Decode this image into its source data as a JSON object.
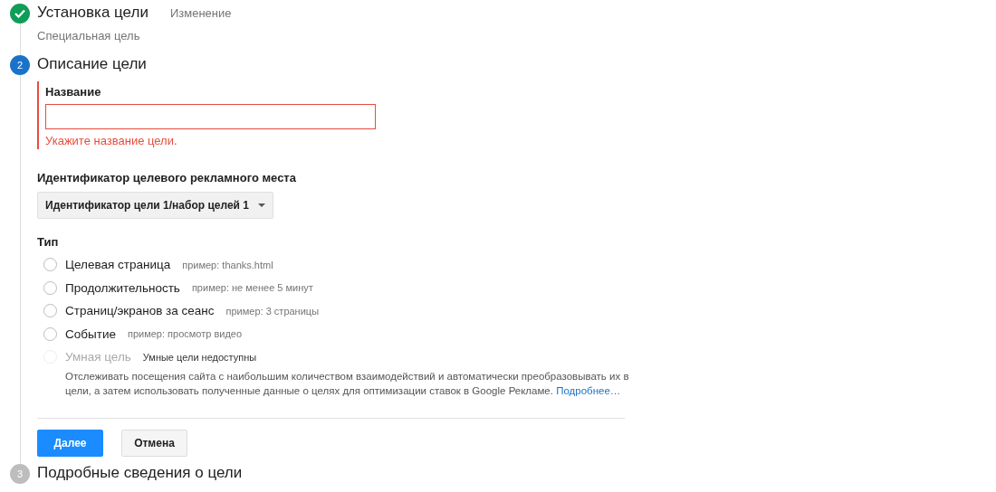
{
  "steps": [
    {
      "done": true,
      "title": "Установка цели",
      "action": "Изменение",
      "summary": "Специальная цель"
    },
    {
      "done": false,
      "active": true,
      "number": "2",
      "title": "Описание цели"
    },
    {
      "done": false,
      "active": false,
      "number": "3",
      "title": "Подробные сведения о цели"
    }
  ],
  "name_field": {
    "label": "Название",
    "invalid": true,
    "error": "Укажите название цели."
  },
  "slot": {
    "label": "Идентификатор целевого рекламного места",
    "value": "Идентификатор цели 1/набор целей 1"
  },
  "type": {
    "label": "Тип",
    "options": [
      {
        "label": "Целевая страница",
        "hint": "пример: thanks.html",
        "selected": false,
        "disabled": false
      },
      {
        "label": "Продолжительность",
        "hint": "пример: не менее 5 минут",
        "selected": false,
        "disabled": false
      },
      {
        "label": "Страниц/экранов за сеанс",
        "hint": "пример: 3 страницы",
        "selected": false,
        "disabled": false
      },
      {
        "label": "Событие",
        "hint": "пример: просмотр видео",
        "selected": false,
        "disabled": false
      },
      {
        "label": "Умная цель",
        "hint": "Умные цели недоступны",
        "selected": false,
        "disabled": true,
        "description": "Отслеживать посещения сайта с наибольшим количеством взаимодействий и автоматически преобразовывать их в цели, а затем использовать полученные данные о целях для оптимизации ставок в Google Рекламе.",
        "link": "Подробнее…"
      }
    ]
  },
  "buttons": [
    {
      "label": "Далее",
      "kind": "primary"
    },
    {
      "label": "Отмена",
      "kind": "secondary"
    }
  ]
}
